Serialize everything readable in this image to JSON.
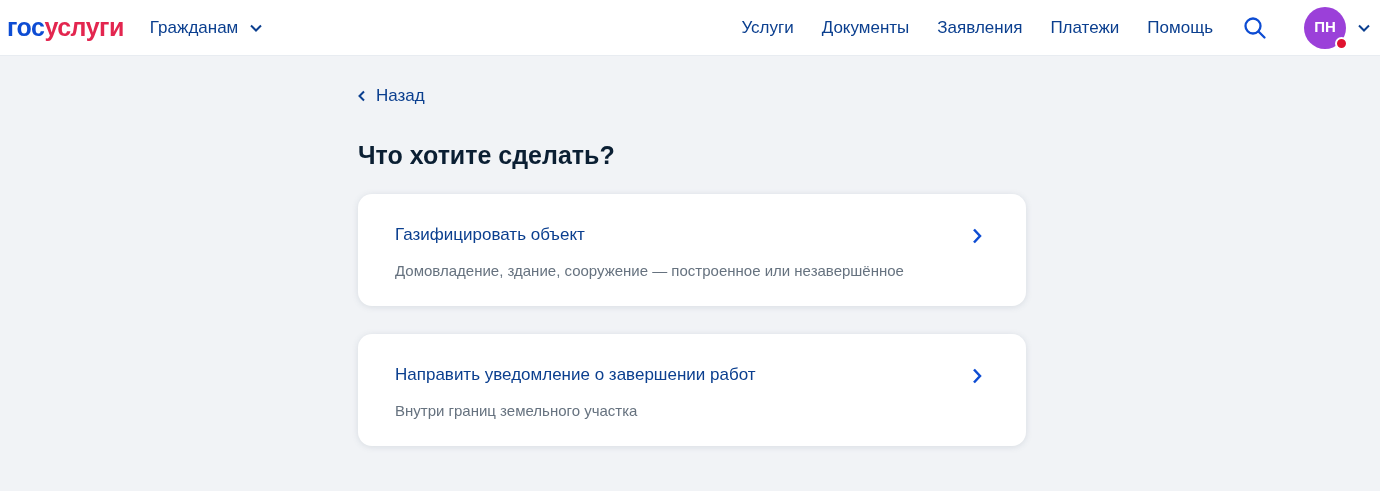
{
  "header": {
    "logo": [
      {
        "text": "гос",
        "color": "#0d4cd3"
      },
      {
        "text": "услуги",
        "color": "#e3264f"
      }
    ],
    "audience": "Гражданам",
    "nav": [
      "Услуги",
      "Документы",
      "Заявления",
      "Платежи",
      "Помощь"
    ],
    "avatar": {
      "initials": "ПН",
      "notification": true
    }
  },
  "back": "Назад",
  "title": "Что хотите сделать?",
  "options": [
    {
      "title": "Газифицировать объект",
      "subtitle": "Домовладение, здание, сооружение — построенное или незавершённое"
    },
    {
      "title": "Направить уведомление о завершении работ",
      "subtitle": "Внутри границ земельного участка"
    }
  ]
}
